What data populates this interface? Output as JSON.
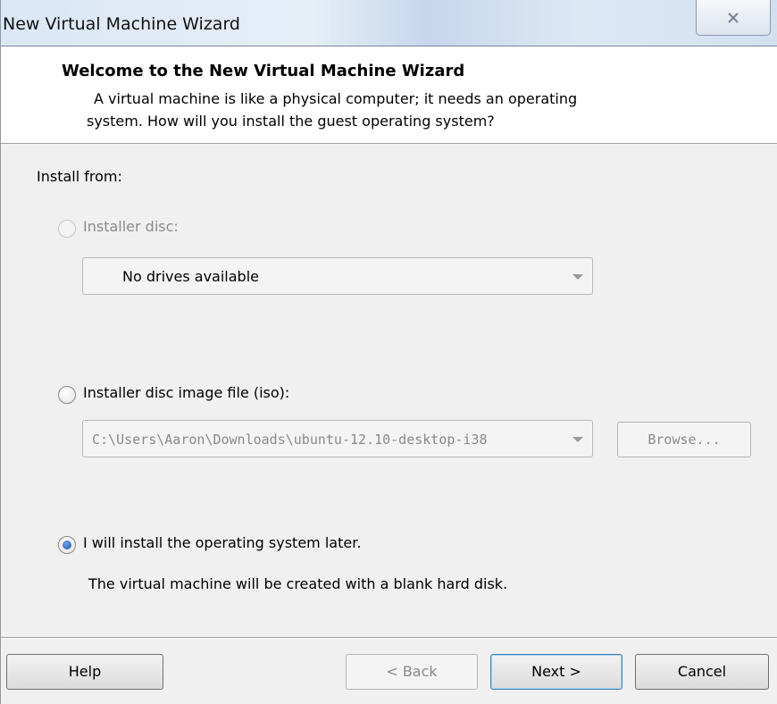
{
  "window": {
    "title": "New Virtual Machine Wizard"
  },
  "header": {
    "title": "Welcome to the New Virtual Machine Wizard",
    "subtitle_line1": "A virtual machine is like a physical computer; it needs an operating",
    "subtitle_line2": "system. How will you install the guest operating system?"
  },
  "body": {
    "install_from_label": "Install from:",
    "options": [
      {
        "label": "Installer disc:",
        "selected": false,
        "enabled": false,
        "combo_value": "No drives available"
      },
      {
        "label": "Installer disc image file (iso):",
        "selected": false,
        "enabled": true,
        "combo_value": "C:\\Users\\Aaron\\Downloads\\ubuntu-12.10-desktop-i38",
        "browse_label": "Browse..."
      },
      {
        "label": "I will install the operating system later.",
        "selected": true,
        "enabled": true,
        "description": "The virtual machine will be created with a blank hard disk."
      }
    ]
  },
  "footer": {
    "help_label": "Help",
    "back_label": "< Back",
    "next_label": "Next >",
    "cancel_label": "Cancel"
  },
  "icons": {
    "close": "close-icon"
  }
}
